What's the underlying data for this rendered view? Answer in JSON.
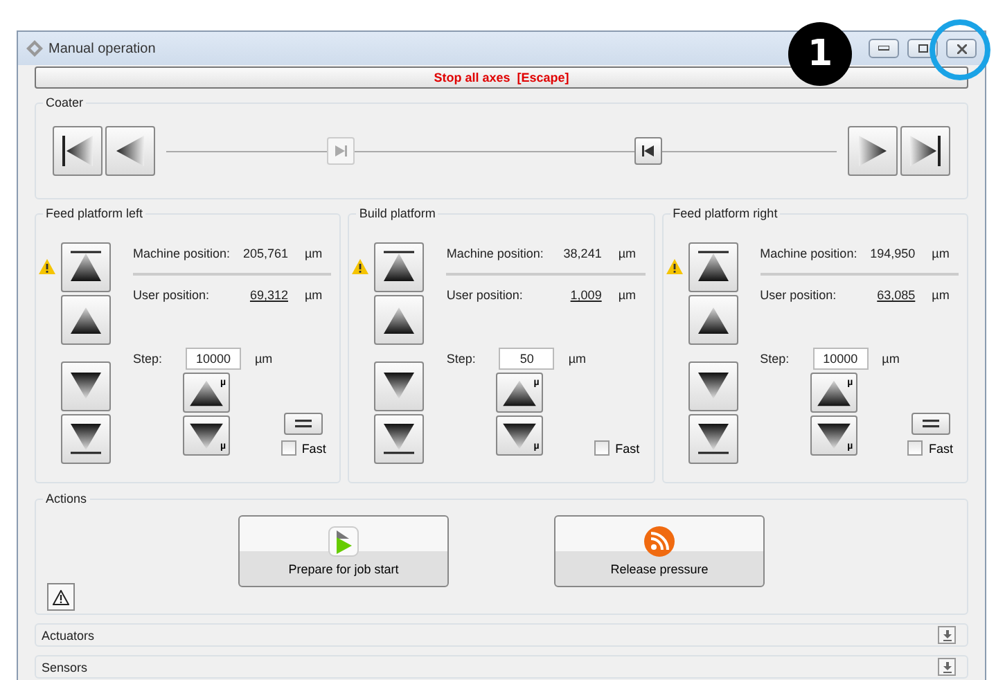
{
  "window": {
    "title": "Manual operation"
  },
  "callout": {
    "label": "1",
    "highlight_close": true
  },
  "stop_button": {
    "label": "Stop all axes  [Escape]"
  },
  "coater": {
    "title": "Coater",
    "markers": [
      {
        "level": 0.26,
        "disabled": true
      },
      {
        "level": 0.72,
        "disabled": false
      }
    ]
  },
  "platforms": [
    {
      "title": "Feed platform left",
      "warning": true,
      "machine_label": "Machine position:",
      "machine_value": "205,761",
      "machine_unit": "µm",
      "user_label": "User position:",
      "user_value": "69,312",
      "user_unit": "µm",
      "step_label": "Step:",
      "step_value": "10000",
      "step_unit": "µm",
      "fine_up_mark": "µ",
      "fine_down_mark": "µ",
      "zero_button": true,
      "fast": {
        "label": "Fast",
        "checked": false
      }
    },
    {
      "title": "Build platform",
      "warning": true,
      "machine_label": "Machine position:",
      "machine_value": "38,241",
      "machine_unit": "µm",
      "user_label": "User position:",
      "user_value": "1,009",
      "user_unit": "µm",
      "step_label": "Step:",
      "step_value": "50",
      "step_unit": "µm",
      "fine_up_mark": "µ",
      "fine_down_mark": "µ",
      "zero_button": false,
      "fast": {
        "label": "Fast",
        "checked": false
      }
    },
    {
      "title": "Feed platform right",
      "warning": true,
      "machine_label": "Machine position:",
      "machine_value": "194,950",
      "machine_unit": "µm",
      "user_label": "User position:",
      "user_value": "63,085",
      "user_unit": "µm",
      "step_label": "Step:",
      "step_value": "10000",
      "step_unit": "µm",
      "fine_up_mark": "µ",
      "fine_down_mark": "µ",
      "zero_button": true,
      "fast": {
        "label": "Fast",
        "checked": false
      }
    }
  ],
  "actions": {
    "title": "Actions",
    "buttons": [
      {
        "label": "Prepare for job start",
        "kind": "play"
      },
      {
        "label": "Release pressure",
        "kind": "rss"
      }
    ]
  },
  "sections": [
    {
      "title": "Actuators",
      "expanded": false
    },
    {
      "title": "Sensors",
      "expanded": false
    }
  ]
}
